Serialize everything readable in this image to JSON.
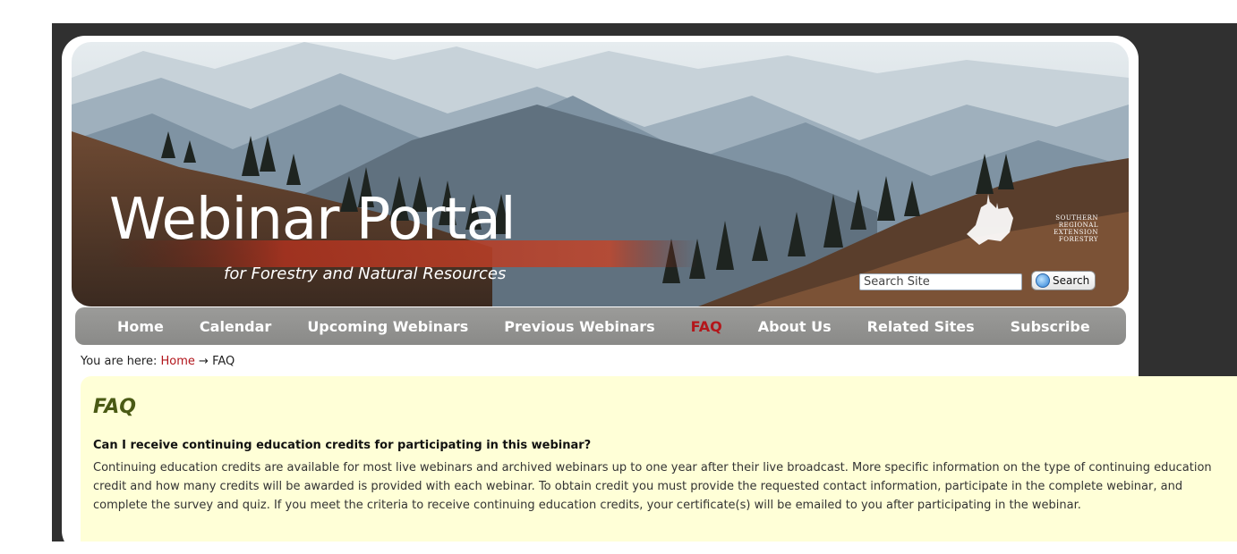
{
  "header": {
    "title": "Webinar Portal",
    "subtitle": "for Forestry and Natural Resources",
    "logo_lines": [
      "SOUTHERN",
      "REGIONAL",
      "EXTENSION",
      "FORESTRY"
    ]
  },
  "search": {
    "placeholder": "Search Site",
    "button_label": "Search"
  },
  "nav": {
    "items": [
      {
        "label": "Home",
        "active": false
      },
      {
        "label": "Calendar",
        "active": false
      },
      {
        "label": "Upcoming Webinars",
        "active": false
      },
      {
        "label": "Previous Webinars",
        "active": false
      },
      {
        "label": "FAQ",
        "active": true
      },
      {
        "label": "About Us",
        "active": false
      },
      {
        "label": "Related Sites",
        "active": false
      },
      {
        "label": "Subscribe",
        "active": false
      }
    ]
  },
  "breadcrumb": {
    "prefix": "You are here:",
    "home": "Home",
    "separator": "→",
    "current": "FAQ"
  },
  "main": {
    "heading": "FAQ",
    "question": "Can I receive continuing education credits for participating in this webinar?",
    "answer": "Continuing education credits are available for most live webinars and archived webinars up to one year after their live broadcast. More specific information on the type of continuing education credit and how many credits will be awarded is provided with each webinar. To obtain credit you must provide the requested contact information, participate in the complete webinar, and complete the survey and quiz. If you meet the criteria to receive continuing education credits, your certificate(s) will be emailed to you after participating in the webinar."
  },
  "colors": {
    "accent_red": "#b4161a",
    "nav_gray": "#949492",
    "content_bg": "#ffffd7",
    "heading_olive": "#4a5a14"
  }
}
